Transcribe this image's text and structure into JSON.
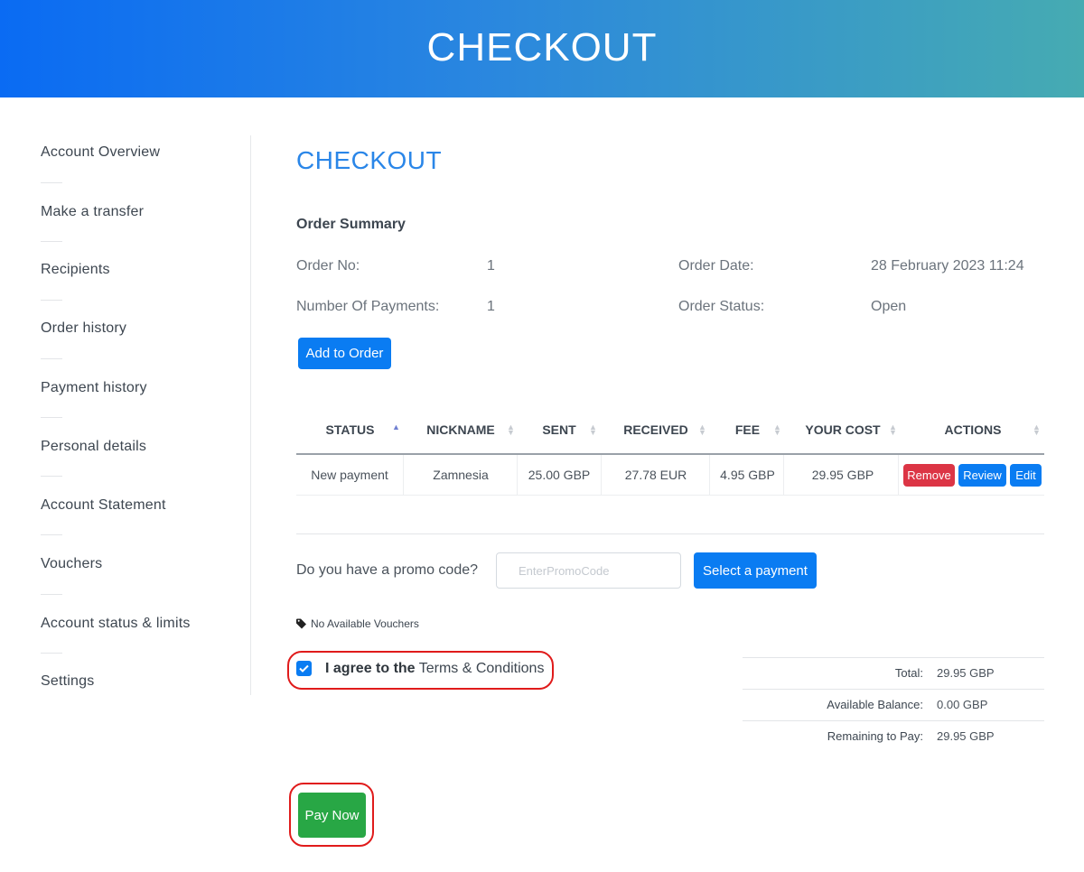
{
  "header": {
    "title": "CHECKOUT"
  },
  "sidebar": {
    "items": [
      {
        "label": "Account Overview"
      },
      {
        "label": "Make a transfer"
      },
      {
        "label": "Recipients"
      },
      {
        "label": "Order history"
      },
      {
        "label": "Payment history"
      },
      {
        "label": "Personal details"
      },
      {
        "label": "Account Statement"
      },
      {
        "label": "Vouchers"
      },
      {
        "label": "Account status & limits"
      },
      {
        "label": "Settings"
      }
    ]
  },
  "main": {
    "title": "CHECKOUT",
    "order_summary_heading": "Order Summary",
    "order_no_label": "Order No:",
    "order_no_value": "1",
    "payments_label": "Number Of Payments:",
    "payments_value": "1",
    "order_date_label": "Order Date:",
    "order_date_value": "28 February 2023 11:24",
    "order_status_label": "Order Status:",
    "order_status_value": "Open",
    "add_to_order": "Add to Order"
  },
  "table": {
    "headers": [
      "STATUS",
      "NICKNAME",
      "SENT",
      "RECEIVED",
      "FEE",
      "YOUR COST",
      "ACTIONS"
    ],
    "rows": [
      {
        "status": "New payment",
        "nickname": "Zamnesia",
        "sent": "25.00 GBP",
        "received": "27.78 EUR",
        "fee": "4.95 GBP",
        "your_cost": "29.95 GBP",
        "actions": {
          "remove": "Remove",
          "review": "Review",
          "edit": "Edit"
        }
      }
    ]
  },
  "promo": {
    "question": "Do you have a promo code?",
    "placeholder": "EnterPromoCode",
    "select_payment": "Select a payment",
    "no_vouchers": "No Available Vouchers"
  },
  "agree": {
    "checked": true,
    "prefix": "I agree to the",
    "link": "Terms & Conditions"
  },
  "summary": {
    "total_label": "Total:",
    "total_value": "29.95 GBP",
    "balance_label": "Available Balance:",
    "balance_value": "0.00 GBP",
    "remaining_label": "Remaining to Pay:",
    "remaining_value": "29.95 GBP"
  },
  "pay_now": "Pay Now",
  "colors": {
    "accent": "#0a7cf2",
    "danger": "#dc3545",
    "success": "#28a745",
    "title_blue": "#2a86e8",
    "highlight": "#e01b1b"
  }
}
